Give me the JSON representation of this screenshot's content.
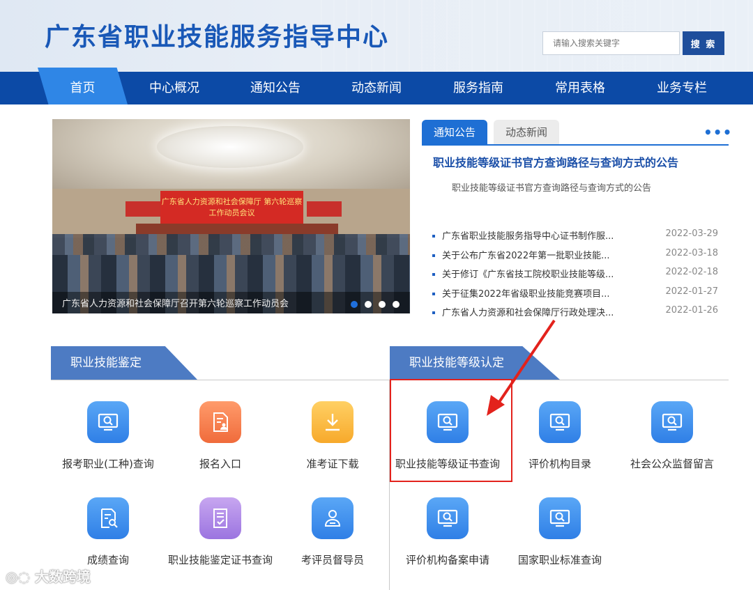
{
  "header": {
    "site_title": "广东省职业技能服务指导中心",
    "search_placeholder": "请输入搜索关键字",
    "search_button": "搜 索"
  },
  "nav": {
    "items": [
      "首页",
      "中心概况",
      "通知公告",
      "动态新闻",
      "服务指南",
      "常用表格",
      "业务专栏"
    ],
    "active_index": 0
  },
  "carousel": {
    "caption": "广东省人力资源和社会保障厅召开第六轮巡察工作动员会",
    "banner_text": "广东省人力资源和社会保障厅 第六轮巡察工作动员会议",
    "dot_count": 4,
    "active_dot": 0
  },
  "news_panel": {
    "tabs": [
      "通知公告",
      "动态新闻"
    ],
    "active_tab": 0,
    "more_icon": "more-dots-icon",
    "headline": "职业技能等级证书官方查询路径与查询方式的公告",
    "headline_summary": "职业技能等级证书官方查询路径与查询方式的公告",
    "items": [
      {
        "title": "广东省职业技能服务指导中心证书制作服...",
        "date": "2022-03-29"
      },
      {
        "title": "关于公布广东省2022年第一批职业技能...",
        "date": "2022-03-18"
      },
      {
        "title": "关于修订《广东省技工院校职业技能等级...",
        "date": "2022-02-18"
      },
      {
        "title": "关于征集2022年省级职业技能竞赛项目...",
        "date": "2022-01-27"
      },
      {
        "title": "广东省人力资源和社会保障厅行政处理决...",
        "date": "2022-01-26"
      }
    ]
  },
  "section_left": {
    "title": "职业技能鉴定",
    "tiles": [
      {
        "label": "报考职业(工种)查询",
        "icon": "monitor-search-icon",
        "color": "blue"
      },
      {
        "label": "报名入口",
        "icon": "document-person-icon",
        "color": "orange"
      },
      {
        "label": "准考证下载",
        "icon": "download-icon",
        "color": "yellow"
      },
      {
        "label": "成绩查询",
        "icon": "document-search-icon",
        "color": "blue"
      },
      {
        "label": "职业技能鉴定证书查询",
        "icon": "document-check-icon",
        "color": "purple"
      },
      {
        "label": "考评员督导员",
        "icon": "user-card-icon",
        "color": "blue"
      }
    ]
  },
  "section_right": {
    "title": "职业技能等级认定",
    "tiles": [
      {
        "label": "职业技能等级证书查询",
        "icon": "monitor-search-icon",
        "color": "blue"
      },
      {
        "label": "评价机构目录",
        "icon": "monitor-search-icon",
        "color": "blue"
      },
      {
        "label": "社会公众监督留言",
        "icon": "monitor-search-icon",
        "color": "blue"
      },
      {
        "label": "评价机构备案申请",
        "icon": "monitor-search-icon",
        "color": "blue"
      },
      {
        "label": "国家职业标准查询",
        "icon": "monitor-search-icon",
        "color": "blue"
      }
    ]
  },
  "annotation": {
    "highlight_color": "#e3221c"
  },
  "watermark": "大数跨境",
  "colors": {
    "nav_bg": "#0c4aa6",
    "nav_active": "#2f86e6",
    "title_blue": "#1958b7",
    "section_head": "#4d7bc3"
  }
}
